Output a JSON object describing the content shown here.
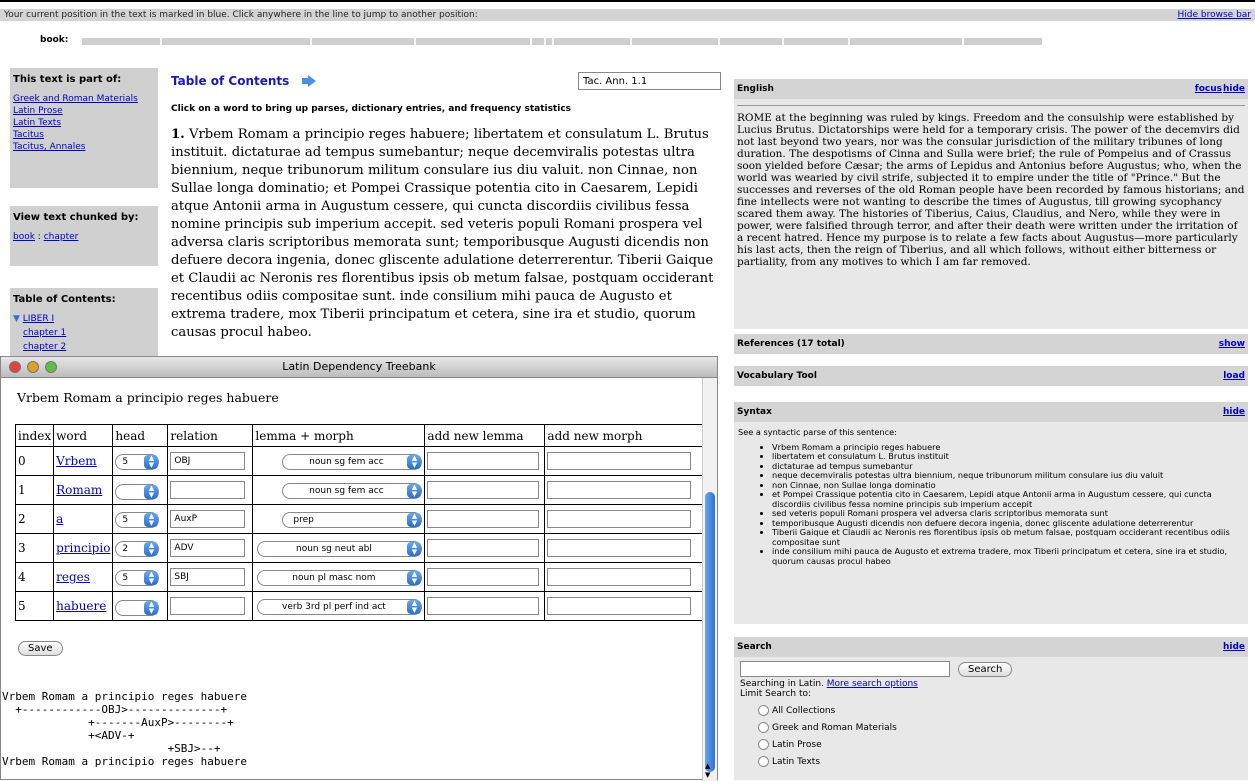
{
  "browse_bar": {
    "message": "Your current position in the text is marked in blue. Click anywhere in the line to jump to another position:",
    "hide_label": "Hide browse bar",
    "book_label": "book:"
  },
  "sidebar": {
    "part_of": {
      "title": "This text is part of:",
      "links": [
        "Greek and Roman Materials",
        "Latin Prose",
        "Latin Texts",
        "Tacitus",
        "Tacitus, Annales"
      ]
    },
    "chunked": {
      "title": "View text chunked by:",
      "book": "book",
      "sep": " : ",
      "chapter": "chapter"
    },
    "toc": {
      "title": "Table of Contents:",
      "liber": "LIBER I",
      "chapter1": "chapter 1",
      "chapter2": "chapter 2"
    }
  },
  "main": {
    "toc_link": "Table of Contents",
    "citation_value": "Tac. Ann. 1.1",
    "instruction": "Click on a word to bring up parses, dictionary entries, and frequency statistics",
    "section_number": "1.",
    "latin_text": " Vrbem Romam a principio reges habuere; libertatem et consulatum L. Brutus instituit. dictaturae ad tempus sumebantur; neque decemviralis potestas ultra biennium, neque tribunorum militum consulare ius diu valuit. non Cinnae, non Sullae longa dominatio; et Pompei Crassique potentia cito in Caesarem, Lepidi atque Antonii arma in Augustum cessere, qui cuncta discordiis civilibus fessa nomine principis sub imperium accepit. sed veteris populi Romani prospera vel adversa claris scriptoribus memorata sunt; temporibusque Augusti dicendis non defuere decora ingenia, donec gliscente adulatione deterrerentur. Tiberii Gaique et Claudii ac Neronis res florentibus ipsis ob metum falsae, postquam occiderant recentibus odiis compositae sunt. inde consilium mihi pauca de Augusto et extrema tradere, mox Tiberii principatum et cetera, sine ira et studio, quorum causas procul habeo."
  },
  "english": {
    "title": "English",
    "focus": "focus",
    "hide": "hide",
    "text": "ROME at the beginning was ruled by kings. Freedom and the consulship were established by Lucius Brutus. Dictatorships were held for a temporary crisis. The power of the decemvirs did not last beyond two years, nor was the consular jurisdiction of the military tribunes of long duration. The despotisms of Cinna and Sulla were brief; the rule of Pompeius and of Crassus soon yielded before Cæsar; the arms of Lepidus and Antonius before Augustus; who, when the world was wearied by civil strife, subjected it to empire under the title of \"Prince.\" But the successes and reverses of the old Roman people have been recorded by famous historians; and fine intellects were not wanting to describe the times of Augustus, till growing sycophancy scared them away. The histories of Tiberius, Caius, Claudius, and Nero, while they were in power, were falsified through terror, and after their death were written under the irritation of a recent hatred. Hence my purpose is to relate a few facts about Augustus—more particularly his last acts, then the reign of Tiberius, and all which follows, without either bitterness or partiality, from any motives to which I am far removed."
  },
  "references": {
    "title": "References (17 total)",
    "action": "show"
  },
  "vocab": {
    "title": "Vocabulary Tool",
    "action": "load"
  },
  "syntax": {
    "title": "Syntax",
    "action": "hide",
    "intro": "See a syntactic parse of this sentence:",
    "items": [
      "Vrbem Romam a principio reges habuere",
      "libertatem et consulatum L. Brutus instituit",
      "dictaturae ad tempus sumebantur",
      "neque decemviralis potestas ultra biennium, neque tribunorum militum consulare ius diu valuit",
      "non Cinnae, non Sullae longa dominatio",
      "et Pompei Crassique potentia cito in Caesarem, Lepidi atque Antonii arma in Augustum cessere, qui cuncta discordiis civilibus fessa nomine principis sub imperium accepit",
      "sed veteris populi Romani prospera vel adversa claris scriptoribus memorata sunt",
      "temporibusque Augusti dicendis non defuere decora ingenia, donec gliscente adulatione deterrerentur",
      "Tiberii Gaique et Claudii ac Neronis res florentibus ipsis ob metum falsae, postquam occiderant recentibus odiis compositae sunt",
      "inde consilium mihi pauca de Augusto et extrema tradere, mox Tiberii principatum et cetera, sine ira et studio, quorum causas procul habeo"
    ]
  },
  "search": {
    "title": "Search",
    "action": "hide",
    "button": "Search",
    "searching_in": "Searching in Latin.",
    "more_options": "More search options",
    "limit": "Limit Search to:",
    "options": [
      "All Collections",
      "Greek and Roman Materials",
      "Latin Prose",
      "Latin Texts"
    ]
  },
  "treebank": {
    "window_title": "Latin Dependency Treebank",
    "sentence": "Vrbem Romam a principio reges habuere",
    "headers": [
      "index",
      "word",
      "head",
      "relation",
      "lemma + morph",
      "add new lemma",
      "add new morph"
    ],
    "rows": [
      {
        "index": "0",
        "word": "Vrbem",
        "head": "5",
        "relation": "OBJ",
        "morph": "noun sg fem acc"
      },
      {
        "index": "1",
        "word": "Romam",
        "head": "",
        "relation": "",
        "morph": "noun sg fem acc"
      },
      {
        "index": "2",
        "word": "a",
        "head": "5",
        "relation": "AuxP",
        "morph": "prep"
      },
      {
        "index": "3",
        "word": "principio",
        "head": "2",
        "relation": "ADV",
        "morph": "noun sg neut abl"
      },
      {
        "index": "4",
        "word": "reges",
        "head": "5",
        "relation": "SBJ",
        "morph": "noun pl masc nom"
      },
      {
        "index": "5",
        "word": "habuere",
        "head": "",
        "relation": "",
        "morph": "verb 3rd pl perf ind act"
      }
    ],
    "save": "Save",
    "ascii_tree": "Vrbem Romam a principio reges habuere\n  +------------OBJ>--------------+\n             +-------AuxP>--------+\n             +<ADV-+\n                         +SBJ>--+\nVrbem Romam a principio reges habuere"
  },
  "colors": {
    "panel_header": "#d4d4d4",
    "link": "#0000cc",
    "accent": "#2c73d2"
  }
}
